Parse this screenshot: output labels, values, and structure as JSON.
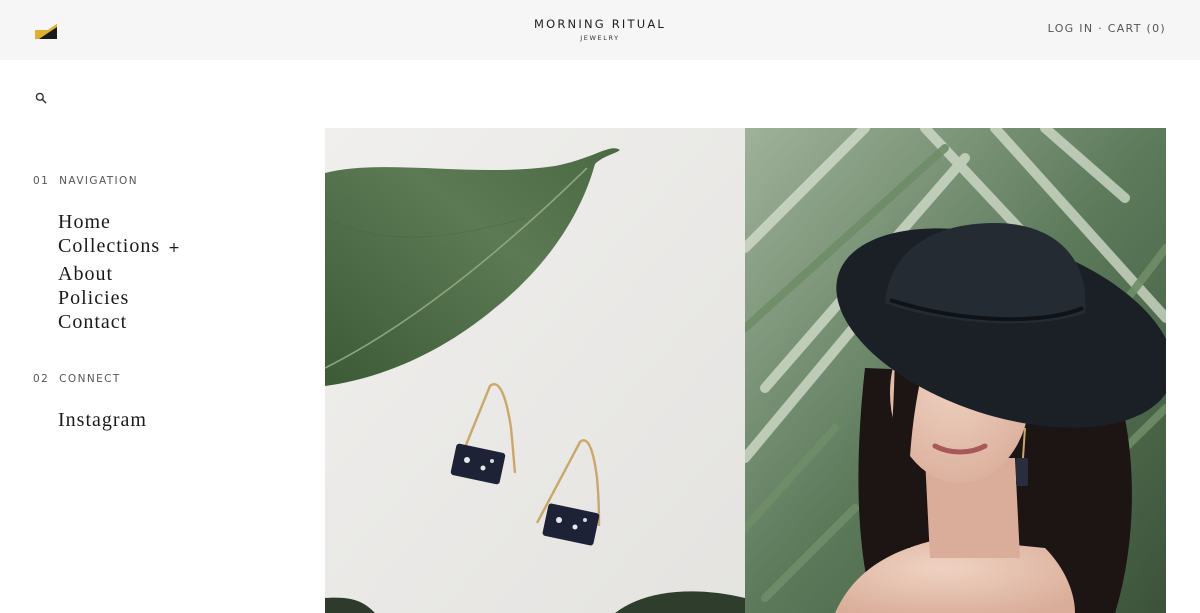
{
  "header": {
    "logo_icon": "brand-logo-icon",
    "brand_name": "MORNING RITUAL",
    "brand_sub": "JEWELRY",
    "login_label": "LOG IN",
    "separator": "·",
    "cart_label": "CART (0)"
  },
  "search": {
    "icon": "search-icon"
  },
  "sidebar": {
    "navigation": {
      "number": "01",
      "title": "NAVIGATION",
      "items": [
        {
          "label": "Home"
        },
        {
          "label": "Collections",
          "expand": "+"
        },
        {
          "label": "About"
        },
        {
          "label": "Policies"
        },
        {
          "label": "Contact"
        }
      ]
    },
    "connect": {
      "number": "02",
      "title": "CONNECT",
      "items": [
        {
          "label": "Instagram"
        }
      ]
    }
  },
  "colors": {
    "header_bg": "#f7f6f6",
    "logo_gold": "#e0b02e",
    "logo_dark": "#1a1a1a"
  }
}
